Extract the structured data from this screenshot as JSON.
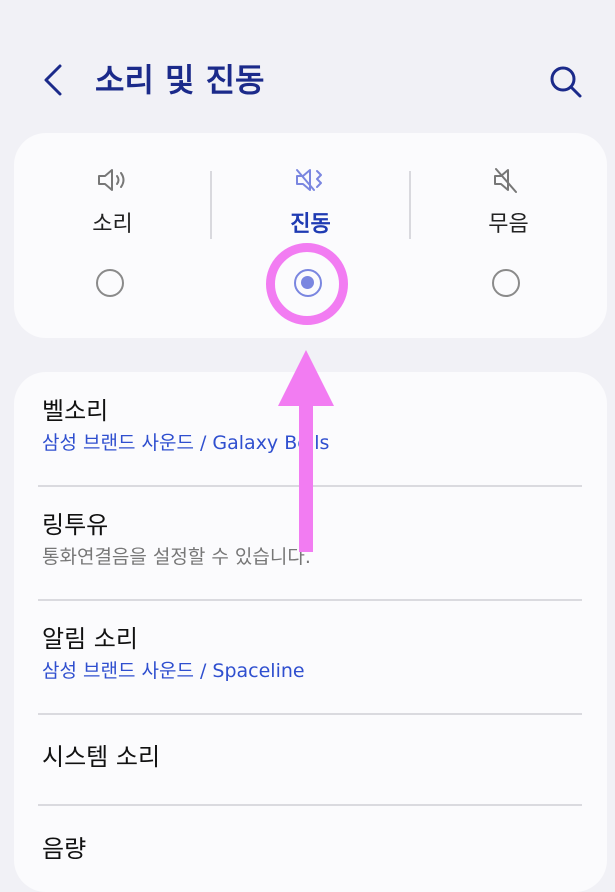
{
  "header": {
    "title": "소리 및 진동",
    "back_icon": "chevron-left-icon",
    "search_icon": "search-icon"
  },
  "sound_modes": [
    {
      "label": "소리",
      "icon": "speaker-icon",
      "selected": false
    },
    {
      "label": "진동",
      "icon": "vibrate-icon",
      "selected": true
    },
    {
      "label": "무음",
      "icon": "mute-icon",
      "selected": false
    }
  ],
  "settings": [
    {
      "title": "벨소리",
      "subtitle": "삼성 브랜드 사운드 / Galaxy Bells"
    },
    {
      "title": "링투유",
      "subtitle": "통화연결음을 설정할 수 있습니다."
    },
    {
      "title": "알림 소리",
      "subtitle": "삼성 브랜드 사운드 / Spaceline"
    },
    {
      "title": "시스템 소리",
      "subtitle": ""
    },
    {
      "title": "음량",
      "subtitle": ""
    }
  ],
  "colors": {
    "accent": "#1f3bb3",
    "subtitle_blue": "#2f4fcf",
    "annotation": "#f27cf2",
    "radio_selected": "#7a86e0"
  }
}
